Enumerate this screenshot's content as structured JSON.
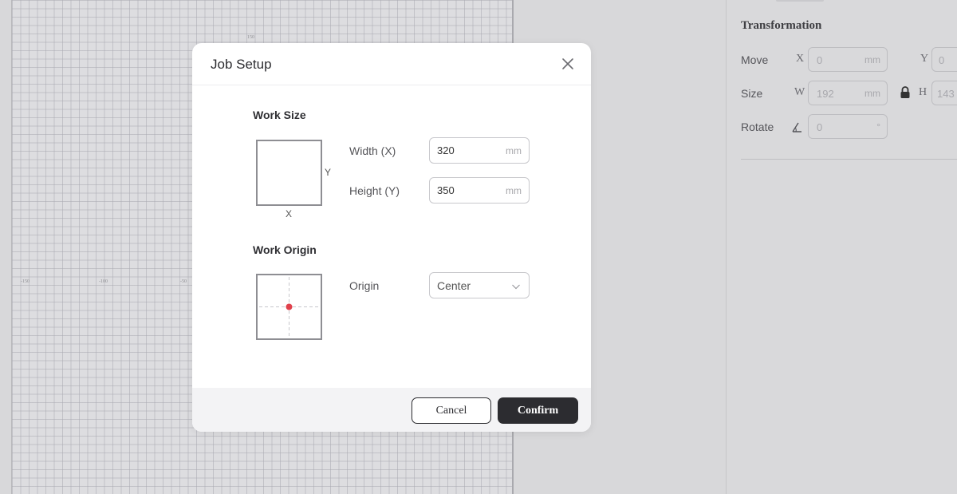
{
  "canvas": {
    "ticks": {
      "top": "150",
      "left_1": "-150",
      "left_2": "-100",
      "left_3": "-50"
    }
  },
  "panel": {
    "title": "Transformation",
    "move": {
      "label": "Move",
      "x_axis": "X",
      "x_value": "0",
      "x_unit": "mm",
      "y_axis": "Y",
      "y_value": "0"
    },
    "size": {
      "label": "Size",
      "w_axis": "W",
      "w_value": "192",
      "w_unit": "mm",
      "h_axis": "H",
      "h_value": "143"
    },
    "rotate": {
      "label": "Rotate",
      "value": "0",
      "unit": "°"
    }
  },
  "modal": {
    "title": "Job Setup",
    "work_size": {
      "title": "Work Size",
      "diagram_x": "X",
      "diagram_y": "Y",
      "width_label": "Width (X)",
      "width_value": "320",
      "width_unit": "mm",
      "height_label": "Height (Y)",
      "height_value": "350",
      "height_unit": "mm"
    },
    "work_origin": {
      "title": "Work Origin",
      "origin_label": "Origin",
      "origin_value": "Center"
    },
    "buttons": {
      "cancel": "Cancel",
      "confirm": "Confirm"
    }
  },
  "colors": {
    "accent": "#2c2c30",
    "origin_dot": "#e0414c"
  }
}
